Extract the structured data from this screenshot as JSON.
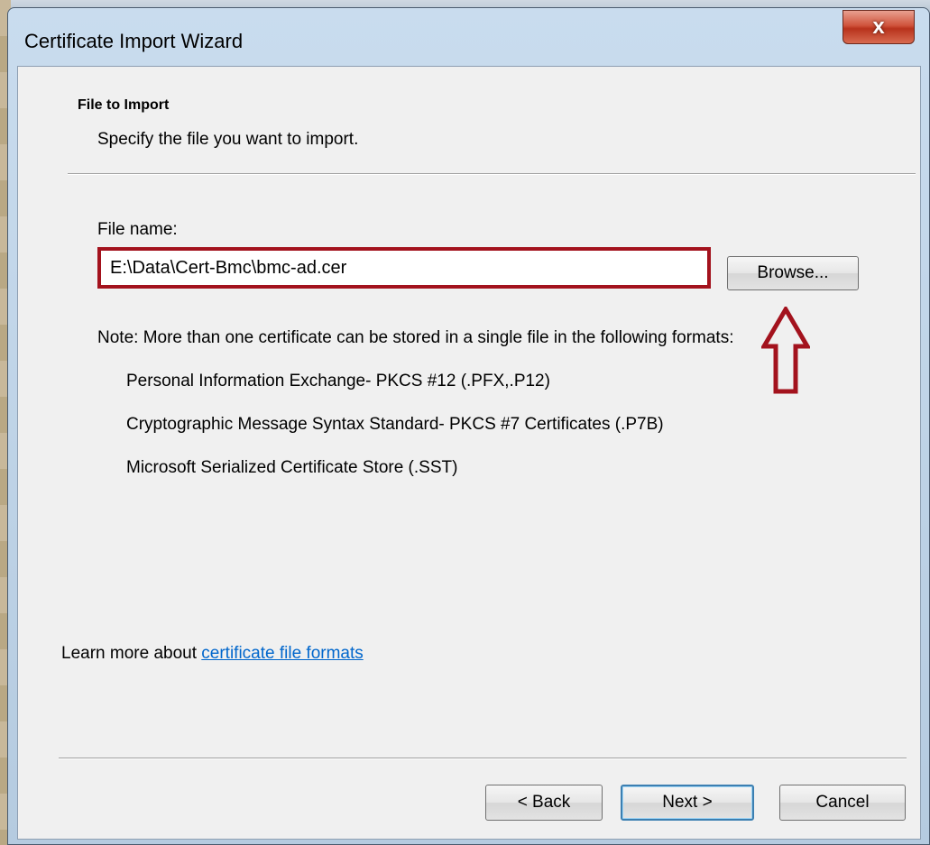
{
  "window": {
    "title": "Certificate Import Wizard",
    "close_label": "x"
  },
  "page": {
    "heading": "File to Import",
    "subheading": "Specify the file you want to import."
  },
  "file": {
    "label": "File name:",
    "value": "E:\\Data\\Cert-Bmc\\bmc-ad.cer",
    "browse_label": "Browse..."
  },
  "note": {
    "text": "Note:  More than one certificate can be stored in a single file in the following formats:",
    "formats": [
      "Personal Information Exchange- PKCS #12 (.PFX,.P12)",
      "Cryptographic Message Syntax Standard- PKCS #7 Certificates (.P7B)",
      "Microsoft Serialized Certificate Store (.SST)"
    ]
  },
  "learn_more": {
    "prefix": "Learn more about ",
    "link": "certificate file formats"
  },
  "buttons": {
    "back": "< Back",
    "next": "Next >",
    "cancel": "Cancel"
  },
  "colors": {
    "highlight": "#a3121d",
    "link": "#0066cc",
    "arrow": "#a3121d"
  },
  "icons": {
    "annotation_arrow": "up-arrow-icon",
    "close": "close-icon"
  }
}
